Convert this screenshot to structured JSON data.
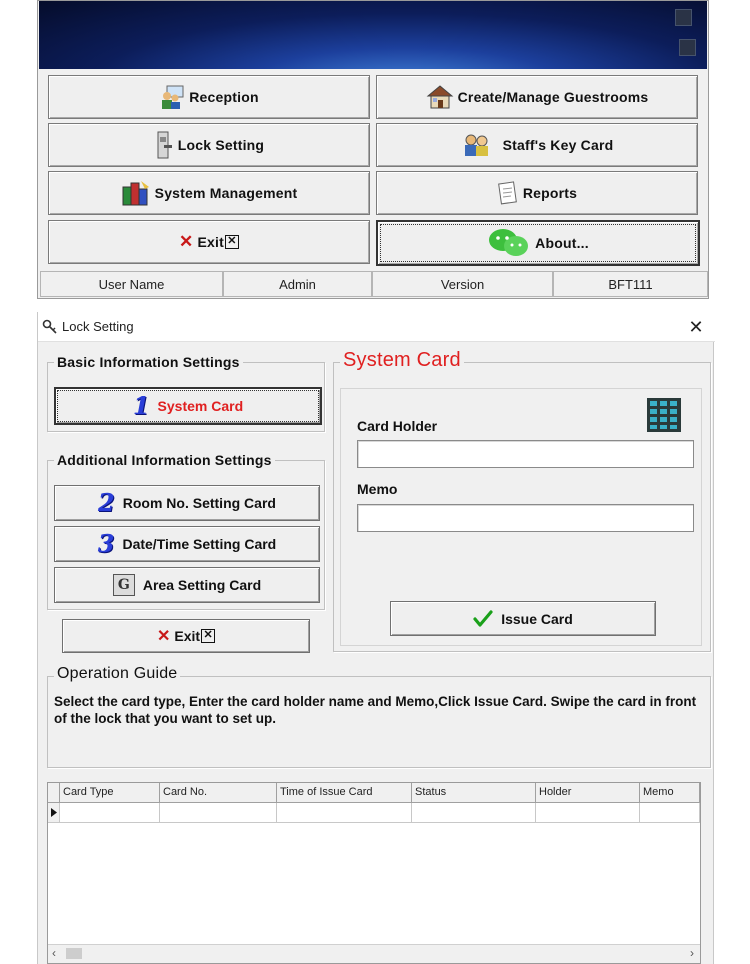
{
  "main": {
    "buttons": {
      "reception": "Reception",
      "create_manage": "Create/Manage Guestrooms",
      "lock_setting": "Lock Setting",
      "staff_key": "Staff's Key Card",
      "system_management": "System Management",
      "reports": "Reports",
      "exit": "Exit",
      "about": "About..."
    },
    "status": {
      "user_label": "User Name",
      "user_value": "Admin",
      "version_label": "Version",
      "version_value": "BFT111"
    }
  },
  "dialog": {
    "title": "Lock Setting",
    "close": "✕",
    "basic_group": "Basic Information Settings",
    "system_card_btn": {
      "num": "1",
      "label": "System Card"
    },
    "additional_group": "Additional Information Settings",
    "room_btn": {
      "num": "2",
      "label": "Room No. Setting Card"
    },
    "date_btn": {
      "num": "3",
      "label": "Date/Time Setting Card"
    },
    "area_btn": {
      "icon": "G",
      "label": "Area Setting Card"
    },
    "exit_btn": "Exit",
    "card_panel": {
      "title": "System Card",
      "card_holder_label": "Card Holder",
      "card_holder_value": "",
      "memo_label": "Memo",
      "memo_value": "",
      "issue_btn": "Issue Card"
    },
    "guide": {
      "title": "Operation Guide",
      "text": "Select the card type, Enter the card holder name and Memo,Click Issue Card. Swipe the card in front of the  lock that you want to set up."
    },
    "grid": {
      "columns": [
        "Card Type",
        "Card No.",
        "Time of Issue Card",
        "Status",
        "Holder",
        "Memo"
      ]
    }
  },
  "colors": {
    "accent_red": "#e02020",
    "number_blue": "#2a3ed8"
  }
}
